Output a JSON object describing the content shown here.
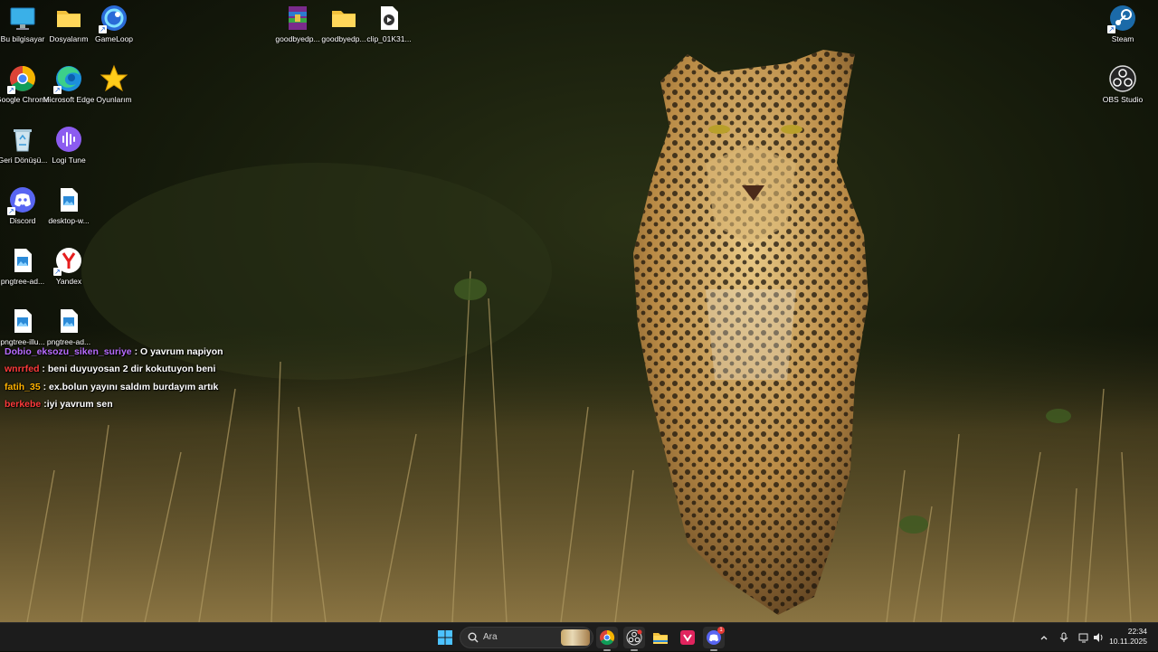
{
  "desktop": {
    "icons": {
      "this_pc": "Bu bilgisayar",
      "files": "Dosyalarım",
      "gameloop": "GameLoop",
      "goodbye1": "goodbyedp...",
      "goodbye2": "goodbyedp...",
      "clip": "clip_01K31...",
      "steam": "Steam",
      "chrome": "Google Chrome",
      "edge": "Microsoft Edge",
      "games": "Oyunlarım",
      "obs": "OBS Studio",
      "recycle": "Geri Dönüşü...",
      "logitune": "Logi Tune",
      "discord": "Discord",
      "desktop_w": "desktop-w...",
      "pngtree_ad1": "pngtree-ad...",
      "yandex": "Yandex",
      "pngtree_illu": "pngtree-illu...",
      "pngtree_ad2": "pngtree-ad..."
    }
  },
  "chat": {
    "messages": [
      {
        "user": "Dobio_eksozu_siken_suriye",
        "text": " : O yavrum napiyon",
        "color": "#b86cff"
      },
      {
        "user": "wnrrfed",
        "text": " : beni duyuyosan 2 dir kokutuyon beni",
        "color": "#ff3b3b"
      },
      {
        "user": "fatih_35",
        "text": " : ex.bolun yayını saldım burdayım artık",
        "color": "#ffb300"
      },
      {
        "user": "berkebe",
        "text": " :iyi yavrum sen",
        "color": "#ff3b3b"
      }
    ]
  },
  "taskbar": {
    "search_placeholder": "Ara",
    "apps": [
      "start-icon",
      "chrome-icon",
      "obs-icon",
      "file-explorer-icon",
      "app-icon",
      "discord-icon"
    ],
    "discord_badge": "1",
    "time": "22:34",
    "date": "10.11.2025"
  },
  "colors": {
    "taskbar_bg": "#1c1c1c",
    "accent": "#0078d4"
  }
}
